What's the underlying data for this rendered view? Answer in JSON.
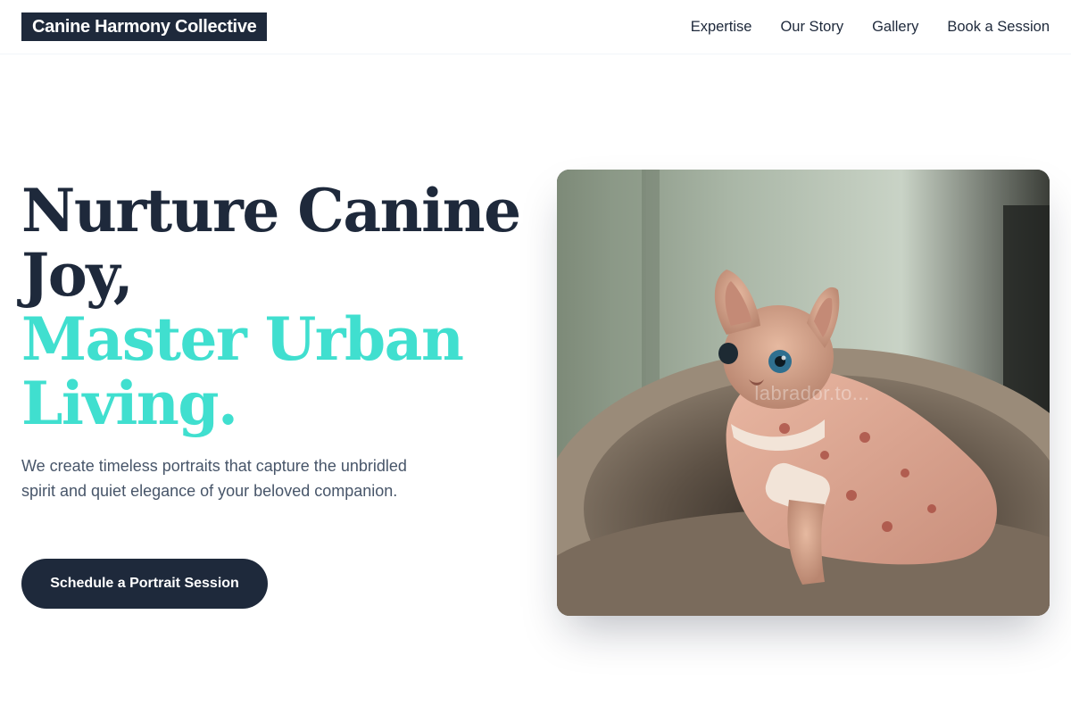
{
  "header": {
    "logo": "Canine Harmony Collective",
    "nav": [
      {
        "label": "Expertise"
      },
      {
        "label": "Our Story"
      },
      {
        "label": "Gallery"
      },
      {
        "label": "Book a Session"
      }
    ]
  },
  "hero": {
    "headline_dark": [
      "Nurture Canine",
      "Joy,"
    ],
    "headline_accent": [
      "Master Urban",
      "Living."
    ],
    "subtitle": "We create timeless portraits that capture the unbridled spirit and quiet elegance of your beloved companion.",
    "cta_label": "Schedule a Portrait Session",
    "image_watermark": "labrador.to..."
  },
  "colors": {
    "brand_dark": "#1e293b",
    "accent": "#40dfcf",
    "body_text": "#475569"
  }
}
